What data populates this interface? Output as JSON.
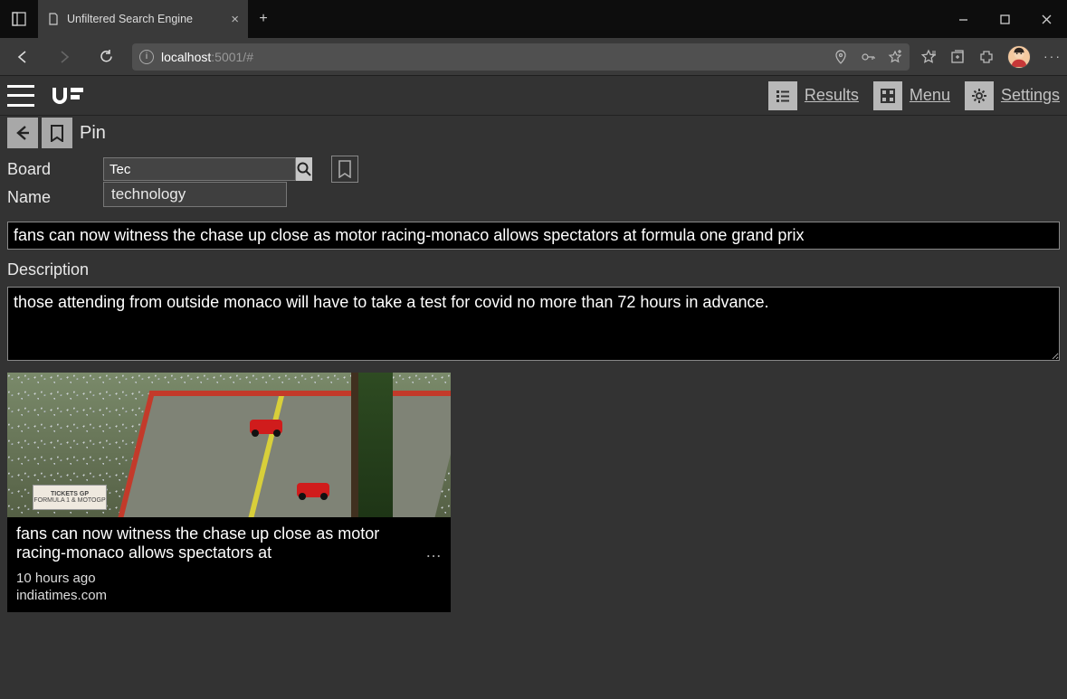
{
  "browser": {
    "tab_title": "Unfiltered Search Engine",
    "url_host": "localhost",
    "url_rest": ":5001/#"
  },
  "header": {
    "logo_text": "UF",
    "nav": {
      "results": "Results",
      "menu": "Menu",
      "settings": "Settings"
    }
  },
  "subbar": {
    "title": "Pin"
  },
  "form": {
    "board_label": "Board",
    "board_value": "Tec",
    "board_suggestion": "technology",
    "name_label": "Name",
    "name_value": "fans can now witness the chase up close as motor racing-monaco allows spectators at formula one grand prix",
    "description_label": "Description",
    "description_value": "those attending from outside monaco will have to take a test for covid no more than 72 hours in advance."
  },
  "card": {
    "title": "fans can now witness the chase up close as motor racing-monaco allows spectators at",
    "ellipsis": "…",
    "time": "10 hours ago",
    "source": "indiatimes.com",
    "banner_top": "TICKETS GP",
    "banner_bottom": "FORMULA 1 & MOTOGP"
  }
}
